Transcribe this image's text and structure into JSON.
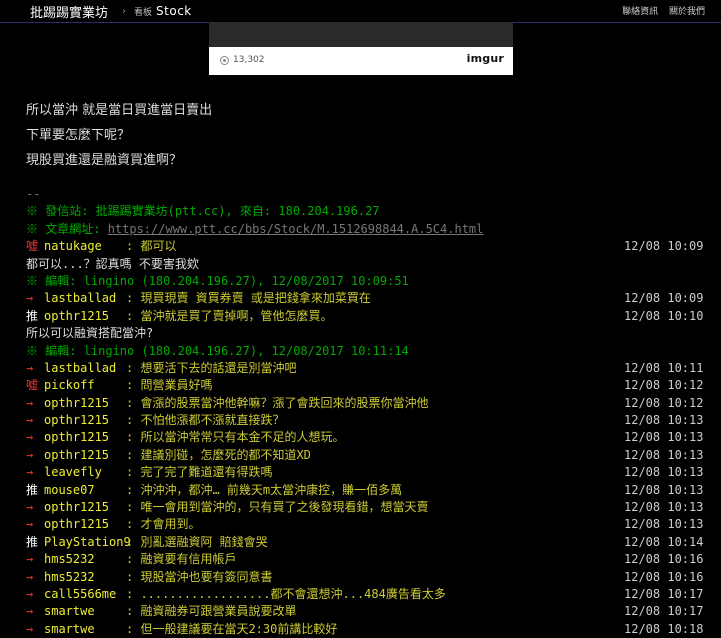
{
  "topbar": {
    "board_title": "批踢踢實業坊",
    "separator": "›",
    "board_tag": "看板",
    "board_name": "Stock",
    "links": [
      "聯絡資訊",
      "關於我們"
    ]
  },
  "imgur": {
    "views": "13,302",
    "logo": "imgur"
  },
  "body_lines": [
    "所以當沖 就是當日買進當日賣出",
    "下單要怎麼下呢？",
    "現股買進還是融資買進啊？"
  ],
  "signature": {
    "dashes": "--",
    "origin": "※ 發信站: 批踢踢實業坊(ptt.cc), 來自: 180.204.196.27",
    "url_label": "※ 文章網址: ",
    "url": "https://www.ptt.cc/bbs/Stock/M.1512698844.A.5C4.html"
  },
  "edit_notes": [
    "※ 編輯: lingino (180.204.196.27), 12/08/2017 10:09:51",
    "※ 編輯: lingino (180.204.196.27), 12/08/2017 10:11:14"
  ],
  "author_lines": [
    "都可以...？認真嗎 不要害我欸",
    "所以可以融資搭配當沖?"
  ],
  "pushes": [
    {
      "tag": "噓",
      "user": "natukage",
      "msg": "都可以",
      "time": "12/08 10:09"
    },
    {
      "tag": "→",
      "user": "lastballad",
      "msg": "現買現賣  資買券賣  或是把錢拿來加菜買在",
      "time": "12/08 10:09"
    },
    {
      "tag": "推",
      "user": "opthr1215",
      "msg": "當沖就是買了賣掉啊，管他怎麼買。",
      "time": "12/08 10:10"
    },
    {
      "tag": "→",
      "user": "lastballad",
      "msg": "想要活下去的話還是別當沖吧",
      "time": "12/08 10:11"
    },
    {
      "tag": "噓",
      "user": "pickoff",
      "msg": "問營業員好嗎",
      "time": "12/08 10:12"
    },
    {
      "tag": "→",
      "user": "opthr1215",
      "msg": "會漲的股票當沖他幹嘛？漲了會跌回來的股票你當沖他",
      "time": "12/08 10:12"
    },
    {
      "tag": "→",
      "user": "opthr1215",
      "msg": "不怕他漲都不漲就直接跌？",
      "time": "12/08 10:13"
    },
    {
      "tag": "→",
      "user": "opthr1215",
      "msg": "所以當沖常常只有本金不足的人想玩。",
      "time": "12/08 10:13"
    },
    {
      "tag": "→",
      "user": "opthr1215",
      "msg": "建議別碰，怎麼死的都不知道XD",
      "time": "12/08 10:13"
    },
    {
      "tag": "→",
      "user": "leavefly",
      "msg": "完了完了難道還有得跌嗎",
      "time": "12/08 10:13"
    },
    {
      "tag": "推",
      "user": "mouse07",
      "msg": "沖沖沖，都沖…   前幾天m太當沖康控，賺一佰多萬",
      "time": "12/08 10:13"
    },
    {
      "tag": "→",
      "user": "opthr1215",
      "msg": "唯一會用到當沖的，只有買了之後發現看錯，想當天賣",
      "time": "12/08 10:13"
    },
    {
      "tag": "→",
      "user": "opthr1215",
      "msg": "才會用到。",
      "time": "12/08 10:13"
    },
    {
      "tag": "推",
      "user": "PlayStation9",
      "msg": "別亂選融資阿 賠錢會哭",
      "time": "12/08 10:14"
    },
    {
      "tag": "→",
      "user": "hms5232",
      "msg": "融資要有信用帳戶",
      "time": "12/08 10:16"
    },
    {
      "tag": "→",
      "user": "hms5232",
      "msg": "現股當沖也要有簽同意書",
      "time": "12/08 10:16"
    },
    {
      "tag": "→",
      "user": "call5566me",
      "msg": "..................都不會還想沖...484廣告看太多",
      "time": "12/08 10:17"
    },
    {
      "tag": "→",
      "user": "smartwe",
      "msg": "融資融券可跟營業員說要改單",
      "time": "12/08 10:17"
    },
    {
      "tag": "→",
      "user": "smartwe",
      "msg": "但一般建議要在當天2:30前講比較好",
      "time": "12/08 10:18"
    }
  ],
  "colors": {
    "push_boo": "#ee3333",
    "push_good": "#ffffff",
    "user": "#eeee33",
    "message": "#cccc33",
    "signature": "#00aa00"
  }
}
